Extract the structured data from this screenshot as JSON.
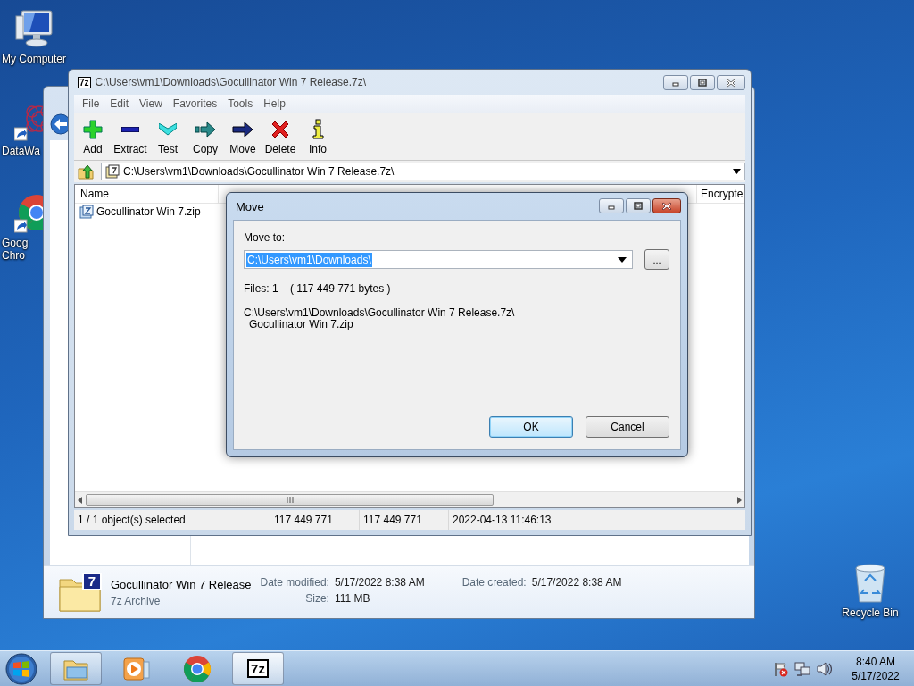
{
  "desktop": {
    "icons": [
      {
        "kind": "computer",
        "label": "My Computer",
        "shortcut": false
      },
      {
        "kind": "network-art",
        "label": "DataWa",
        "shortcut": true
      },
      {
        "kind": "chrome",
        "label": "Goog\nChro",
        "shortcut": true
      }
    ],
    "recycle_bin": {
      "label": "Recycle Bin"
    }
  },
  "explorer": {
    "details": {
      "icon_text": "7",
      "name": "Gocullinator Win 7 Release",
      "type": "7z Archive",
      "fields": [
        {
          "label": "Date modified:",
          "value": "5/17/2022 8:38 AM"
        },
        {
          "label": "Size:",
          "value": "111 MB"
        },
        {
          "label": "Date created:",
          "value": "5/17/2022 8:38 AM"
        }
      ]
    }
  },
  "sevenzip": {
    "active": false,
    "icon_text": "7z",
    "title": "C:\\Users\\vm1\\Downloads\\Gocullinator Win 7 Release.7z\\",
    "menu": [
      "File",
      "Edit",
      "View",
      "Favorites",
      "Tools",
      "Help"
    ],
    "toolbar": [
      {
        "kind": "add",
        "label": "Add"
      },
      {
        "kind": "extract",
        "label": "Extract"
      },
      {
        "kind": "test",
        "label": "Test"
      },
      {
        "kind": "copy",
        "label": "Copy"
      },
      {
        "kind": "move",
        "label": "Move"
      },
      {
        "kind": "delete",
        "label": "Delete"
      },
      {
        "kind": "info",
        "label": "Info"
      }
    ],
    "address": "C:\\Users\\vm1\\Downloads\\Gocullinator Win 7 Release.7z\\",
    "columns": [
      "Name",
      "Encrypte"
    ],
    "rows": [
      {
        "name": "Gocullinator Win 7.zip",
        "selected": false
      }
    ],
    "status": [
      "1 / 1 object(s) selected",
      "117 449 771",
      "117 449 771",
      "2022-04-13 11:46:13"
    ]
  },
  "move_dialog": {
    "active": true,
    "title": "Move",
    "label": "Move to:",
    "path": {
      "value": "C:\\Users\\vm1\\Downloads\\",
      "selected": true
    },
    "browse": "...",
    "files": "Files: 1    ( 117 449 771 bytes )",
    "archive": {
      "path": "C:\\Users\\vm1\\Downloads\\Gocullinator Win 7 Release.7z\\",
      "children": [
        {
          "name": "Gocullinator Win 7.zip"
        }
      ]
    },
    "buttons": [
      {
        "label": "OK",
        "default": true
      },
      {
        "label": "Cancel",
        "default": false
      }
    ]
  },
  "taskbar": {
    "buttons": [
      {
        "kind": "explorer",
        "running": true,
        "selected": false
      },
      {
        "kind": "media-player",
        "running": false,
        "selected": false
      },
      {
        "kind": "chrome",
        "running": false,
        "selected": false
      },
      {
        "kind": "sevenzip",
        "icon_text": "7z",
        "running": true,
        "selected": true
      }
    ],
    "tray": {
      "time": "8:40 AM",
      "date": "5/17/2022"
    }
  }
}
